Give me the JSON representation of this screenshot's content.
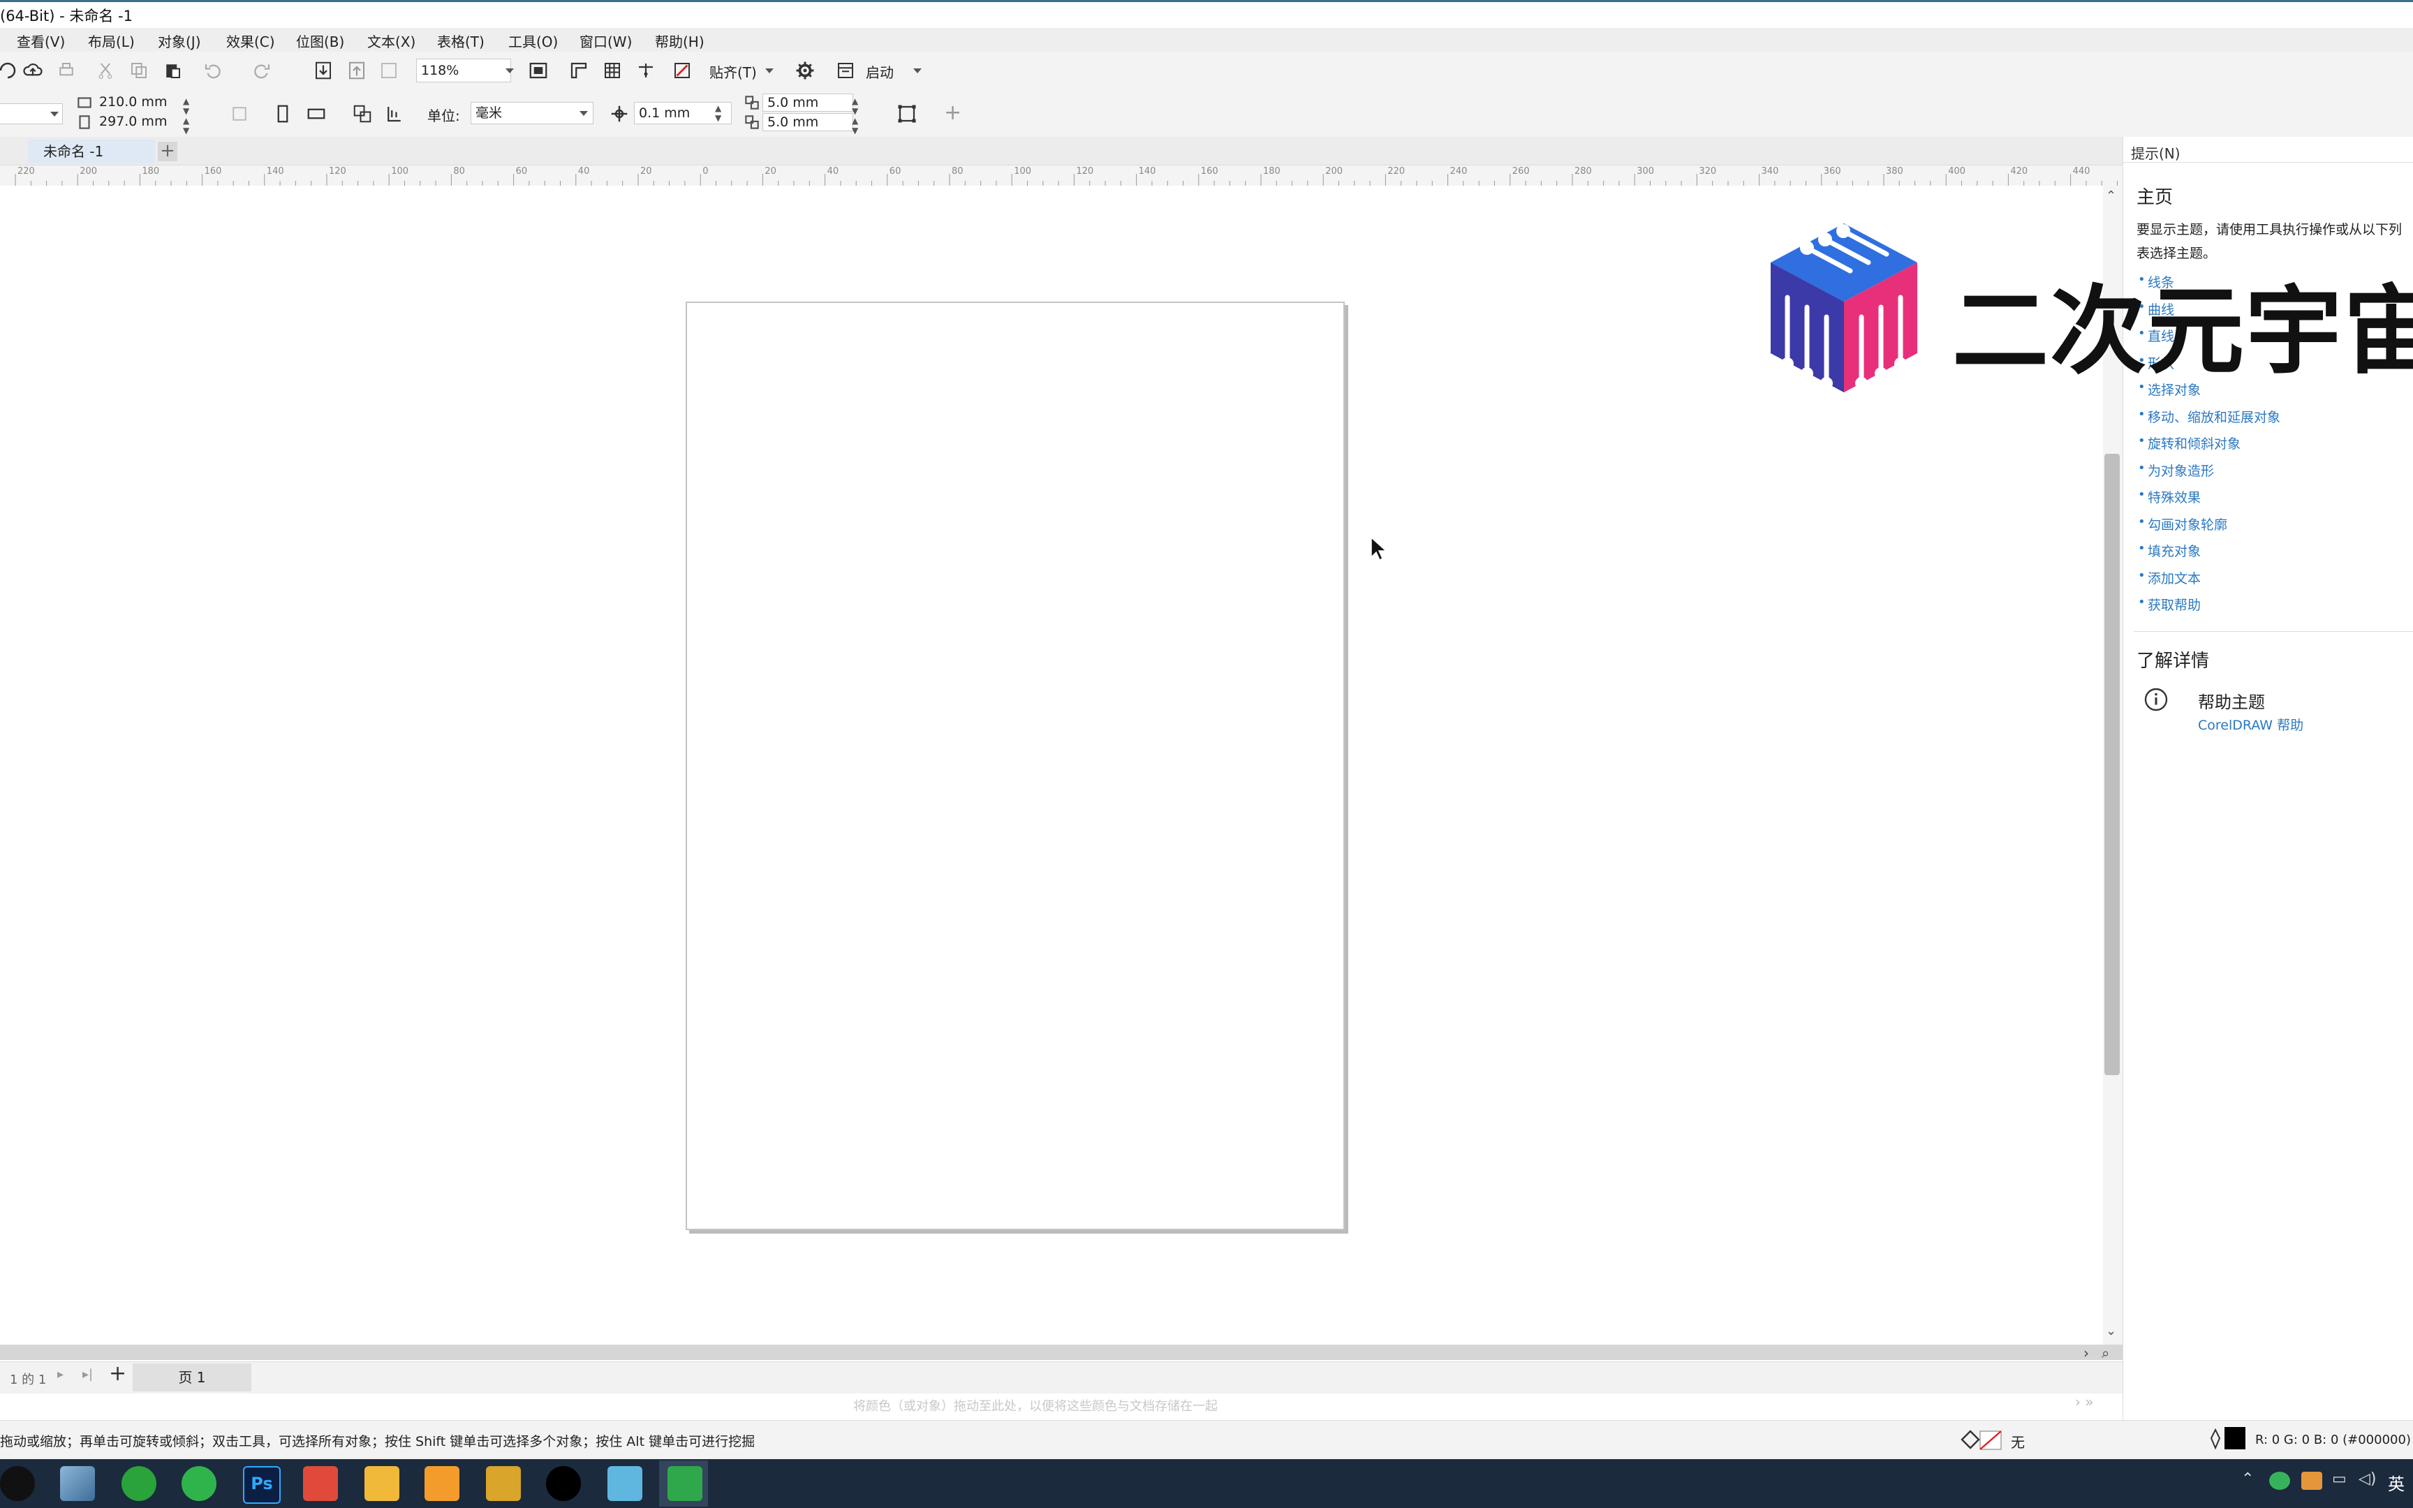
{
  "window": {
    "title": "(64-Bit) - 未命名 -1"
  },
  "menu": [
    "查看(V)",
    "布局(L)",
    "对象(J)",
    "效果(C)",
    "位图(B)",
    "文本(X)",
    "表格(T)",
    "工具(O)",
    "窗口(W)",
    "帮助(H)"
  ],
  "toolbar": {
    "zoom": "118%",
    "snap_label": "贴齐(T)",
    "launch_label": "启动"
  },
  "properties": {
    "width": "210.0 mm",
    "height": "297.0 mm",
    "unit_label": "单位:",
    "unit_value": "毫米",
    "nudge": "0.1 mm",
    "dup_x": "5.0 mm",
    "dup_y": "5.0 mm"
  },
  "document": {
    "tab_name": "未命名 -1"
  },
  "ruler": {
    "labels": [
      "220",
      "200",
      "180",
      "160",
      "140",
      "120",
      "100",
      "80",
      "60",
      "40",
      "20",
      "0",
      "20",
      "40",
      "60",
      "80",
      "100",
      "120",
      "140",
      "160",
      "180",
      "200",
      "220",
      "240",
      "260",
      "280",
      "300",
      "320",
      "340",
      "360",
      "380",
      "400",
      "420",
      "440"
    ]
  },
  "page_nav": {
    "page_count": "1 的 1",
    "page_tab": "页 1"
  },
  "palette_hint": "将颜色（或对象）拖动至此处，以便将这些颜色与文档存储在一起",
  "status": {
    "hint": "拖动或缩放；再单击可旋转或倾斜；双击工具，可选择所有对象；按住 Shift 键单击可选择多个对象；按住 Alt 键单击可进行挖掘",
    "fill_label": "无",
    "color_readout": "R: 0 G: 0 B: 0 (#000000)"
  },
  "docker": {
    "title": "提示(N)",
    "home_heading": "主页",
    "intro": "要显示主题，请使用工具执行操作或从以下列表选择主题。",
    "topics": [
      "线条",
      "曲线",
      "直线",
      "形状",
      "选择对象",
      "移动、缩放和延展对象",
      "旋转和倾斜对象",
      "为对象造形",
      "特殊效果",
      "勾画对象轮廓",
      "填充对象",
      "添加文本",
      "获取帮助"
    ],
    "learn_more": "了解详情",
    "help_topic": "帮助主题",
    "help_link": "CorelDRAW 帮助"
  },
  "watermark": {
    "text": "二次元宇宙"
  },
  "taskbar": {
    "ime": "英"
  },
  "colors": {
    "accent": "#2b79c2",
    "taskbar": "#1b2a3d",
    "tab": "#dfe9f6"
  }
}
